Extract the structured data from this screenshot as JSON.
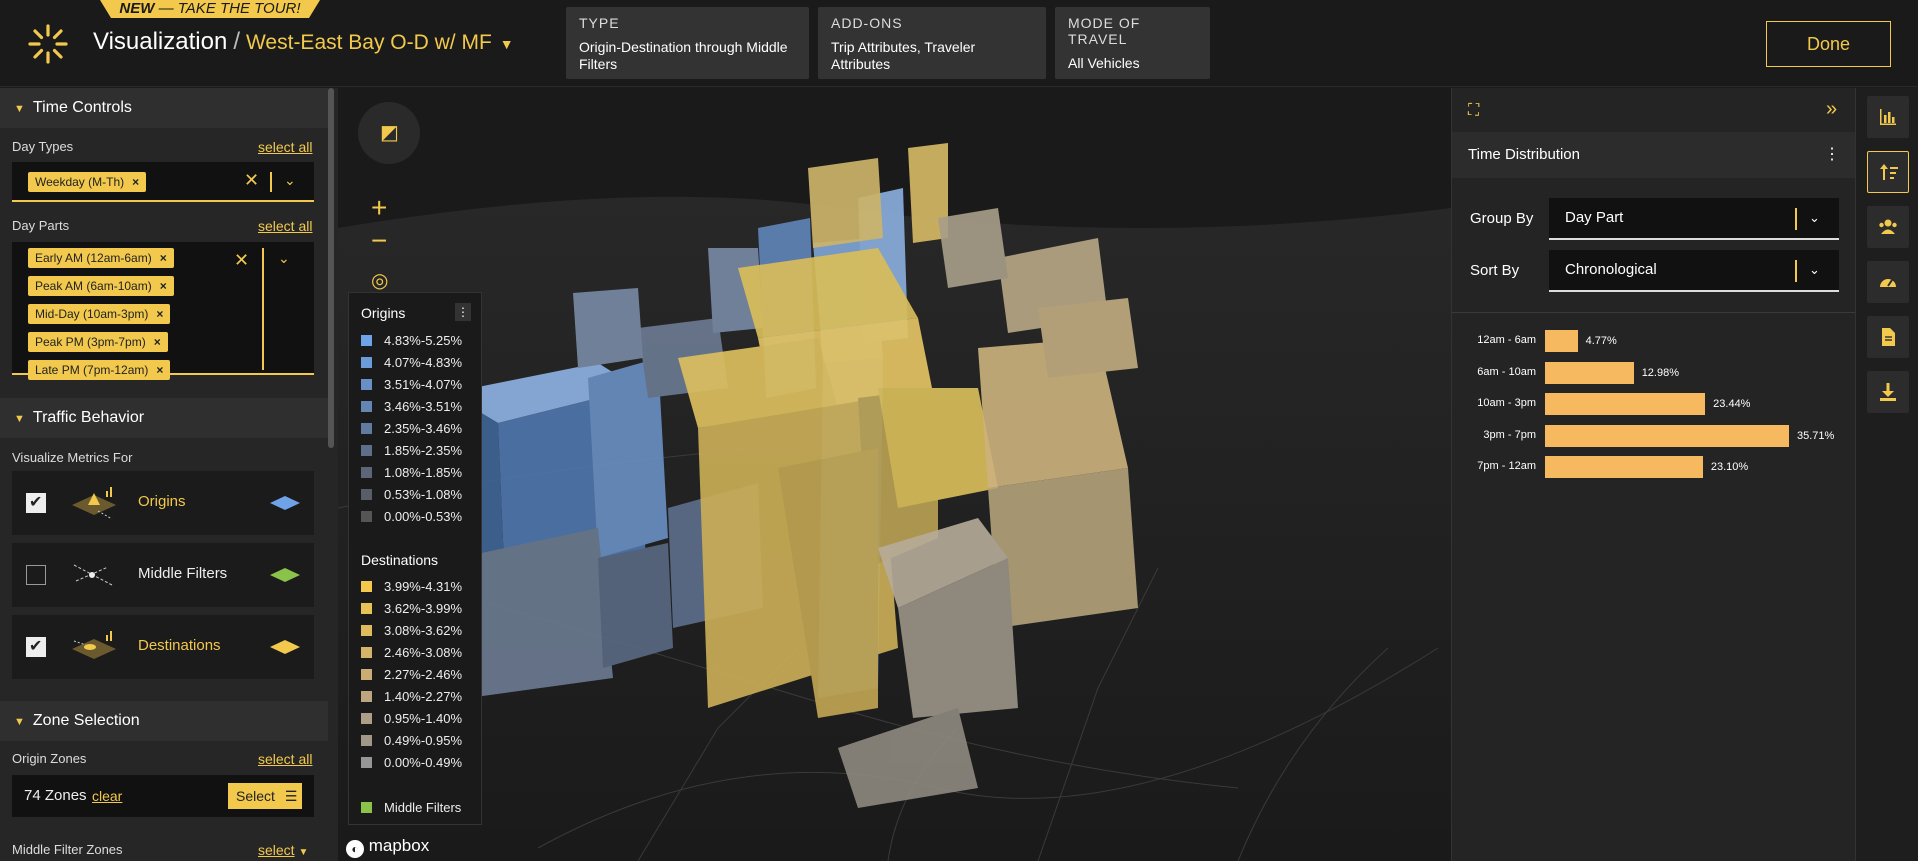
{
  "header": {
    "tour_new": "NEW",
    "tour_text": " — TAKE THE TOUR!",
    "breadcrumb_root": "Visualization",
    "breadcrumb_sep": "/",
    "project_name": "West-East Bay O-D w/ MF",
    "cards": [
      {
        "label": "TYPE",
        "value": "Origin-Destination through Middle Filters"
      },
      {
        "label": "ADD-ONS",
        "value": "Trip Attributes, Traveler Attributes"
      },
      {
        "label": "MODE OF TRAVEL",
        "value": "All Vehicles"
      }
    ],
    "done_label": "Done"
  },
  "left_panel": {
    "time_controls": {
      "title": "Time Controls",
      "day_types_label": "Day Types",
      "select_all": "select all",
      "day_types": [
        "Weekday (M-Th)"
      ],
      "day_parts_label": "Day Parts",
      "day_parts": [
        "Early AM (12am-6am)",
        "Peak AM (6am-10am)",
        "Mid-Day (10am-3pm)",
        "Peak PM (3pm-7pm)",
        "Late PM (7pm-12am)"
      ]
    },
    "traffic_behavior": {
      "title": "Traffic Behavior",
      "subtitle": "Visualize Metrics For",
      "metrics": [
        {
          "name": "Origins",
          "checked": true,
          "color": "#6fa3e8"
        },
        {
          "name": "Middle Filters",
          "checked": false,
          "color": "#8bc34a"
        },
        {
          "name": "Destinations",
          "checked": true,
          "color": "#f2c94c"
        }
      ]
    },
    "zone_selection": {
      "title": "Zone Selection",
      "origin_label": "Origin Zones",
      "select_all": "select all",
      "origin_count": "74 Zones",
      "clear": "clear",
      "select_btn": "Select",
      "middle_label": "Middle Filter Zones",
      "middle_select": "select"
    }
  },
  "legend": {
    "origins_title": "Origins",
    "origins": [
      {
        "range": "4.83%-5.25%",
        "color": "#6fa3e8"
      },
      {
        "range": "4.07%-4.83%",
        "color": "#6b9bd8"
      },
      {
        "range": "3.51%-4.07%",
        "color": "#6890c6"
      },
      {
        "range": "3.46%-3.51%",
        "color": "#6585b3"
      },
      {
        "range": "2.35%-3.46%",
        "color": "#617aa0"
      },
      {
        "range": "1.85%-2.35%",
        "color": "#5e6f8c"
      },
      {
        "range": "1.08%-1.85%",
        "color": "#5b6679"
      },
      {
        "range": "0.53%-1.08%",
        "color": "#585d67"
      },
      {
        "range": "0.00%-0.53%",
        "color": "#555555"
      }
    ],
    "destinations_title": "Destinations",
    "destinations": [
      {
        "range": "3.99%-4.31%",
        "color": "#f2c94c"
      },
      {
        "range": "3.62%-3.99%",
        "color": "#e9c255"
      },
      {
        "range": "3.08%-3.62%",
        "color": "#dfbb5e"
      },
      {
        "range": "2.46%-3.08%",
        "color": "#d4b468"
      },
      {
        "range": "2.27%-2.46%",
        "color": "#c9ad74"
      },
      {
        "range": "1.40%-2.27%",
        "color": "#bca67f"
      },
      {
        "range": "0.95%-1.40%",
        "color": "#ae9e88"
      },
      {
        "range": "0.49%-0.95%",
        "color": "#a29889"
      },
      {
        "range": "0.00%-0.49%",
        "color": "#969696"
      }
    ],
    "middle_filters": {
      "label": "Middle Filters",
      "color": "#8bc34a"
    }
  },
  "map": {
    "attribution": "mapbox"
  },
  "right_panel": {
    "title": "Time Distribution",
    "group_by_label": "Group By",
    "group_by_value": "Day Part",
    "sort_by_label": "Sort By",
    "sort_by_value": "Chronological",
    "chart_data": {
      "type": "bar",
      "orientation": "horizontal",
      "categories": [
        "12am - 6am",
        "6am - 10am",
        "10am - 3pm",
        "3pm - 7pm",
        "7pm - 12am"
      ],
      "values": [
        4.77,
        12.98,
        23.44,
        35.71,
        23.1
      ],
      "value_labels": [
        "4.77%",
        "12.98%",
        "23.44%",
        "35.71%",
        "23.10%"
      ],
      "color": "#f7b960"
    }
  },
  "icon_bar": [
    "bar-chart-icon",
    "sort-icon",
    "users-icon",
    "gauge-icon",
    "document-icon",
    "download-icon"
  ]
}
